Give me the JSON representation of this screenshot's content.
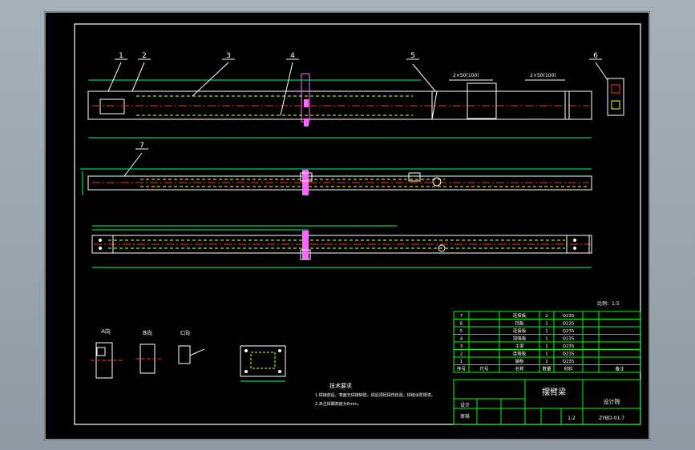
{
  "colors": {
    "background": "#000000",
    "viewport": "#9aa5ae",
    "frame": "#ffffff",
    "outline": "#ffffff",
    "dimension": "#00ff7f",
    "centerline": "#ff2a2a",
    "hidden": "#ffff00",
    "section": "#ff66ff",
    "table_border": "#00ff00",
    "text": "#ffffff"
  },
  "balloons": [
    "1",
    "2",
    "3",
    "4",
    "5",
    "6",
    "7"
  ],
  "view_labels": {
    "detail_a": "A向",
    "detail_b": "B向",
    "detail_c": "C向"
  },
  "weld_symbols": [
    "2×50(100)",
    "2×50(100)"
  ],
  "notes": {
    "title": "技术要求",
    "line1": "1.焊接前后、表面无焊接缺陷，焊后须经探伤检验，焊缝涂防锈漆。",
    "line2": "2.未注焊脚高度为6mm。"
  },
  "scale_note": "比例：1:5",
  "bom": {
    "rows": [
      {
        "no": "7",
        "name": "连接板",
        "qty": "2",
        "material": "Q235"
      },
      {
        "no": "6",
        "name": "挡板",
        "qty": "1",
        "material": "Q235"
      },
      {
        "no": "5",
        "name": "连接板",
        "qty": "1",
        "material": "Q235"
      },
      {
        "no": "4",
        "name": "加强板",
        "qty": "1",
        "material": "Q235"
      },
      {
        "no": "3",
        "name": "主梁",
        "qty": "1",
        "material": "Q235"
      },
      {
        "no": "2",
        "name": "连接板",
        "qty": "1",
        "material": "Q235"
      },
      {
        "no": "1",
        "name": "端板",
        "qty": "1",
        "material": "Q235"
      }
    ],
    "header": {
      "no": "序号",
      "code": "代号",
      "name": "名称",
      "qty": "数量",
      "material": "材料",
      "remark": "备注"
    }
  },
  "title_block": {
    "part_name": "摆臂梁",
    "company": "设计院",
    "drawing_no": "ZYBD-01.7",
    "scale": "1:2",
    "designer": "设计",
    "checker": "审核"
  }
}
